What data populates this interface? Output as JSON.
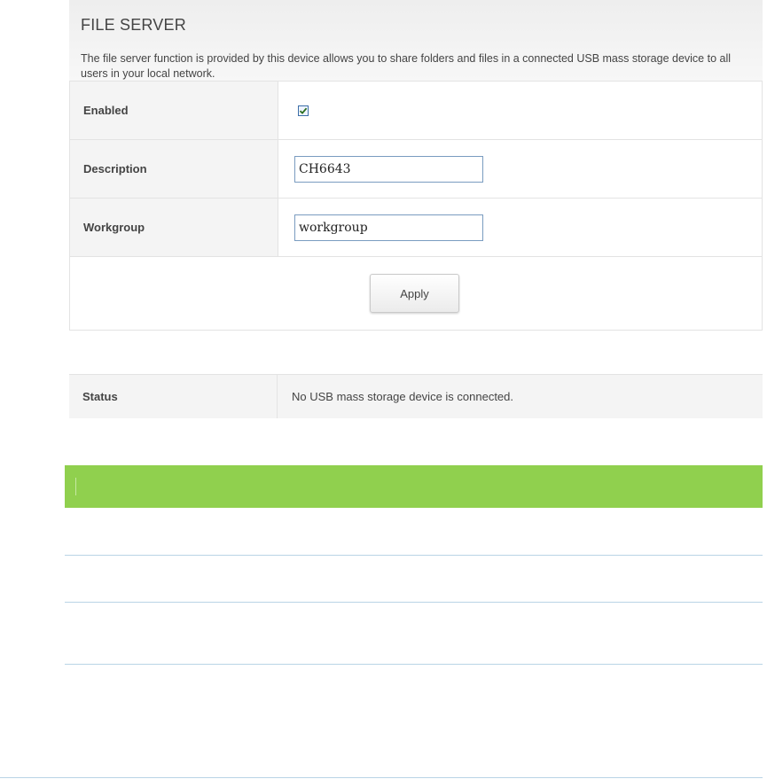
{
  "header": {
    "title": "FILE SERVER",
    "description": "The file server function is provided by this device allows you to share folders and files in a connected USB mass storage device to all users in your local network."
  },
  "form": {
    "enabled_label": "Enabled",
    "enabled_checked": true,
    "description_label": "Description",
    "description_value": "CH6643",
    "workgroup_label": "Workgroup",
    "workgroup_value": "workgroup",
    "apply_label": "Apply"
  },
  "status": {
    "label": "Status",
    "value": "No USB mass storage device is connected."
  },
  "colors": {
    "green_bar": "#90d04e",
    "divider": "#b9d4e6"
  }
}
